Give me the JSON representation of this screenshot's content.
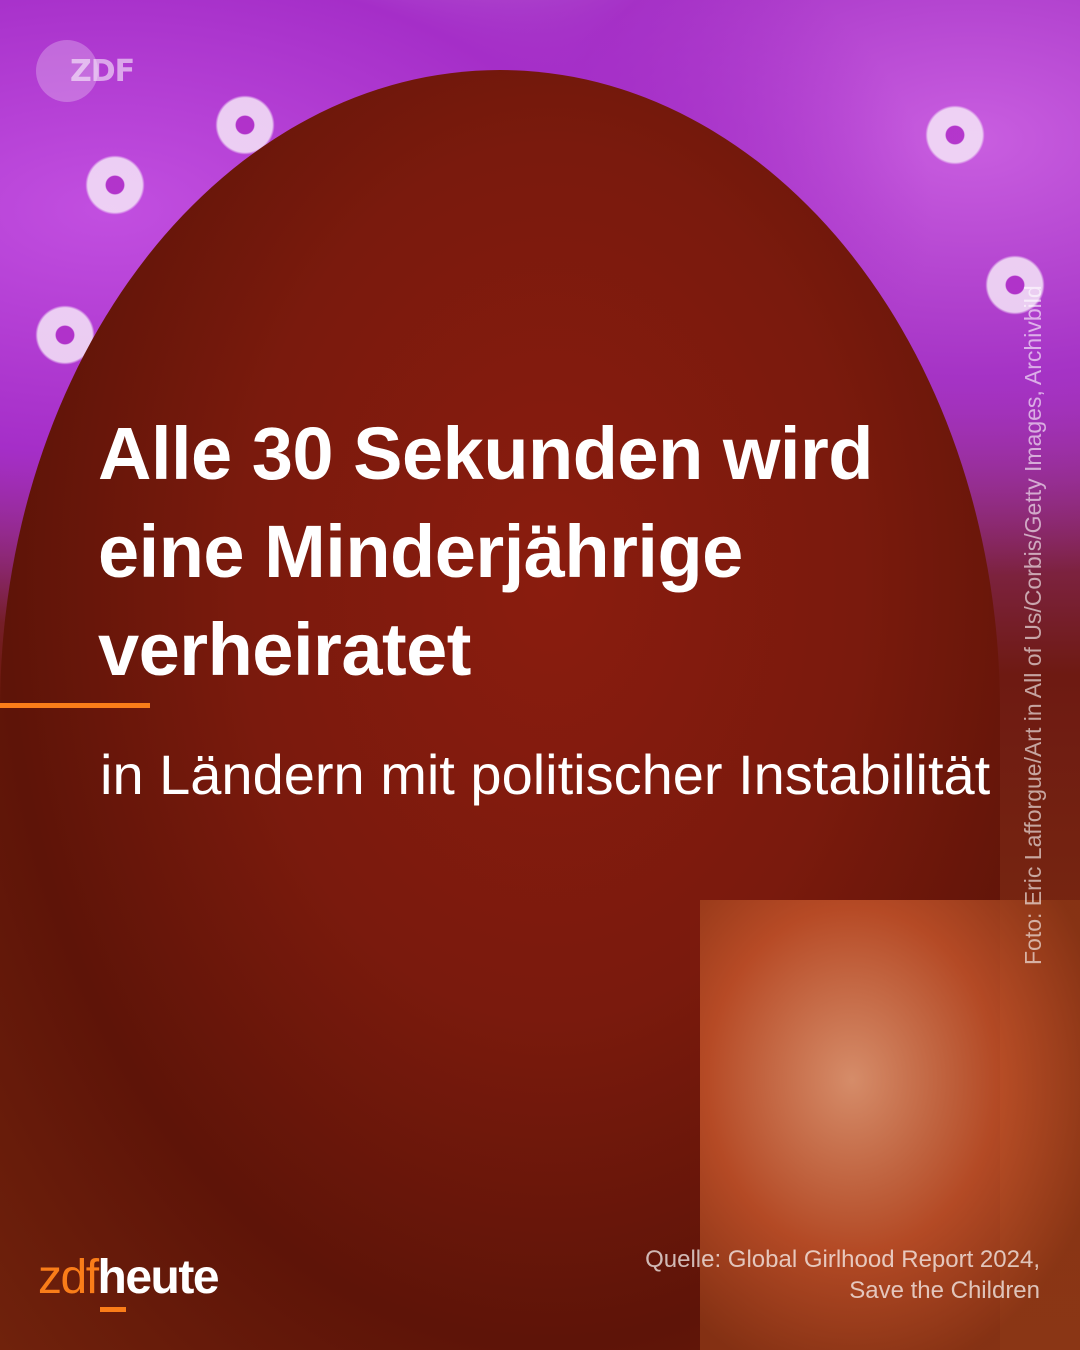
{
  "watermark": "ZDF",
  "headline": "Alle 30 Sekunden wird eine Minderjährige verheiratet",
  "subline": "in Ländern mit politischer Instabilität",
  "photo_credit": "Foto: Eric Lafforgue/Art in All of Us/Corbis/Getty Images, Archivbild",
  "logo": {
    "part1": "zdf",
    "part2": "heute"
  },
  "source": {
    "line1": "Quelle: Global Girlhood Report 2024,",
    "line2": "Save the Children"
  },
  "colors": {
    "accent": "#fa7d19",
    "text": "#ffffff"
  }
}
